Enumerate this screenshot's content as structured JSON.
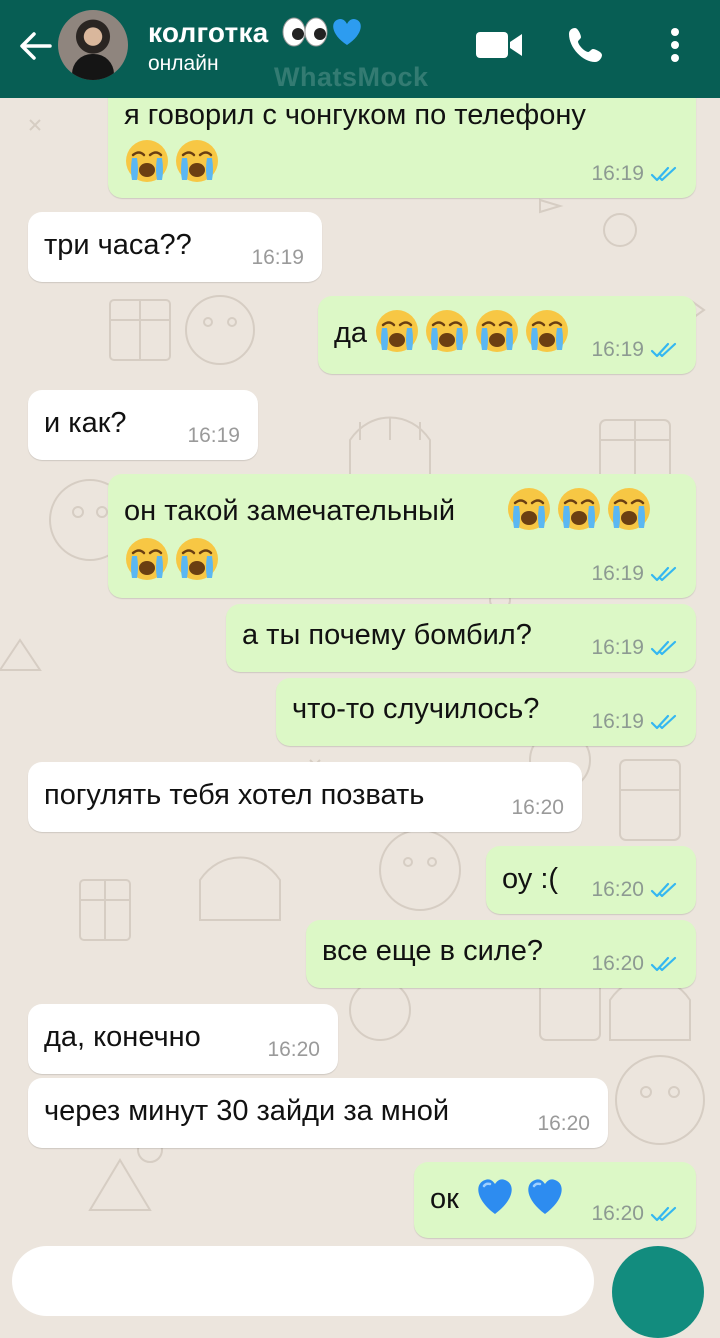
{
  "header": {
    "contact_name": "колготка",
    "status": "онлайн",
    "watermark": "WhatsMock"
  },
  "colors": {
    "header": "#075e54",
    "outgoing_bubble": "#dcf8c6",
    "incoming_bubble": "#ffffff",
    "read_ticks": "#34b7f1",
    "fab": "#128c7e"
  },
  "icons": {
    "back": "arrow-left",
    "video": "video-camera",
    "call": "phone",
    "menu": "three-dots-vertical",
    "contact_name_emoji": [
      "eyes",
      "blue-heart"
    ],
    "read_receipt": "double-check-blue"
  },
  "messages": [
    {
      "dir": "out",
      "text": "я говорил с чонгуком по телефону",
      "emoji": [
        "loudly-crying",
        "loudly-crying"
      ],
      "time": "16:19"
    },
    {
      "dir": "in",
      "text": "три часа??",
      "time": "16:19"
    },
    {
      "dir": "out",
      "text": "да",
      "emoji": [
        "loudly-crying",
        "loudly-crying",
        "loudly-crying",
        "loudly-crying"
      ],
      "time": "16:19"
    },
    {
      "dir": "in",
      "text": "и как?",
      "time": "16:19"
    },
    {
      "dir": "out",
      "text": "он такой замечательный",
      "emoji": [
        "loudly-crying",
        "loudly-crying",
        "loudly-crying",
        "loudly-crying",
        "loudly-crying"
      ],
      "time": "16:19"
    },
    {
      "dir": "out",
      "text": "а ты почему бомбил?",
      "time": "16:19"
    },
    {
      "dir": "out",
      "text": "что-то случилось?",
      "time": "16:19"
    },
    {
      "dir": "in",
      "text": "погулять тебя хотел позвать",
      "time": "16:20"
    },
    {
      "dir": "out",
      "text": "оу :(",
      "time": "16:20"
    },
    {
      "dir": "out",
      "text": "все еще в силе?",
      "time": "16:20"
    },
    {
      "dir": "in",
      "text": "да, конечно",
      "time": "16:20"
    },
    {
      "dir": "in",
      "text": "через минут 30 зайди за мной",
      "time": "16:20"
    },
    {
      "dir": "out",
      "text": "ок",
      "emoji": [
        "blue-heart",
        "blue-heart"
      ],
      "time": "16:20"
    }
  ]
}
